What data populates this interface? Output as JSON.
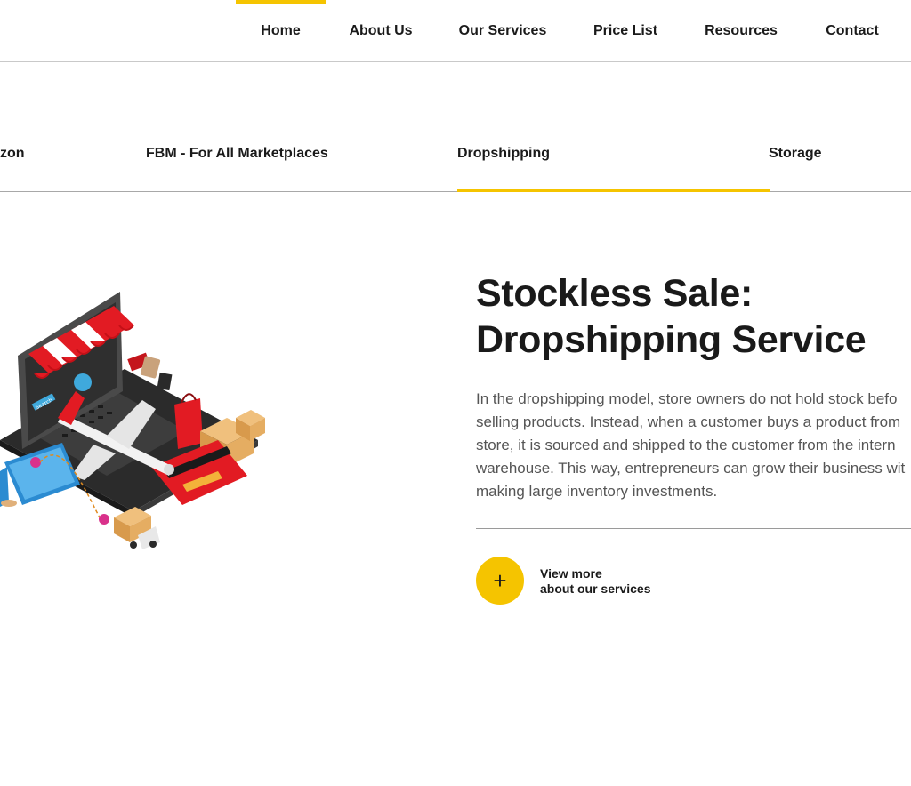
{
  "nav": {
    "items": [
      {
        "label": "Home",
        "active": true
      },
      {
        "label": "About Us"
      },
      {
        "label": "Our Services"
      },
      {
        "label": "Price List"
      },
      {
        "label": "Resources"
      },
      {
        "label": "Contact"
      }
    ],
    "accent_color": "#f5c400"
  },
  "service_tabs": [
    {
      "label": "zon"
    },
    {
      "label": "FBM - For All Marketplaces"
    },
    {
      "label": "Dropshipping",
      "active": true
    },
    {
      "label": "Storage"
    }
  ],
  "main": {
    "title_line1": "Stockless Sale:",
    "title_line2": "Dropshipping Service",
    "description_lines": [
      "In the dropshipping model, store owners do not hold stock befo",
      "selling products. Instead, when a customer buys a product from",
      "store, it is sourced and shipped to the customer from the intern",
      "warehouse. This way, entrepreneurs can grow their business wit",
      "making large inventory investments."
    ],
    "cta": {
      "icon": "plus-icon",
      "line1": "View more",
      "line2": "about our services"
    }
  },
  "illustration": {
    "badge_text": "Search"
  }
}
